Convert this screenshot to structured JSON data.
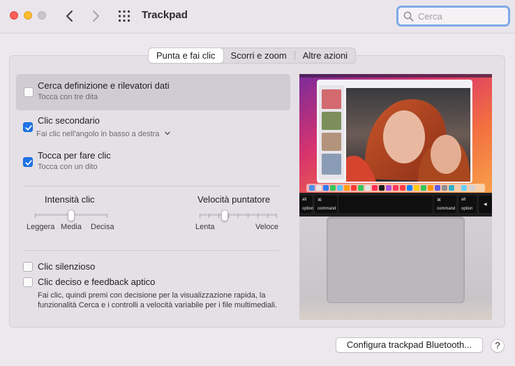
{
  "window": {
    "title": "Trackpad",
    "search_placeholder": "Cerca"
  },
  "tabs": [
    {
      "label": "Punta e fai clic",
      "active": true
    },
    {
      "label": "Scorri e zoom",
      "active": false
    },
    {
      "label": "Altre azioni",
      "active": false
    }
  ],
  "options": {
    "lookup": {
      "title": "Cerca definizione e rilevatori dati",
      "subtitle": "Tocca con tre dita",
      "checked": false
    },
    "secondary_click": {
      "title": "Clic secondario",
      "subtitle": "Fai clic nell'angolo in basso a destra",
      "checked": true
    },
    "tap_to_click": {
      "title": "Tocca per fare clic",
      "subtitle": "Tocca con un dito",
      "checked": true
    },
    "silent_click": {
      "title": "Clic silenzioso",
      "checked": false
    },
    "force_click": {
      "title": "Clic deciso e feedback aptico",
      "checked": false,
      "description": "Fai clic, quindi premi con decisione per la visualizzazione rapida, la funzionalità Cerca e i controlli a velocità variabile per i file multimediali."
    }
  },
  "sliders": {
    "click_intensity": {
      "label": "Intensità clic",
      "min_label": "Leggera",
      "mid_label": "Media",
      "max_label": "Decisa",
      "value_fraction": 0.5
    },
    "pointer_speed": {
      "label": "Velocità puntatore",
      "min_label": "Lenta",
      "max_label": "Veloce",
      "value_fraction": 0.333
    }
  },
  "preview": {
    "keys": {
      "alt": "alt",
      "option": "option",
      "command": "command",
      "cmd_symbol": "⌘"
    }
  },
  "footer": {
    "bluetooth_button": "Configura trackpad Bluetooth...",
    "help": "?"
  },
  "colors": {
    "accent": "#1c73e8",
    "close": "#fe5f57",
    "minimize": "#febc2e"
  }
}
